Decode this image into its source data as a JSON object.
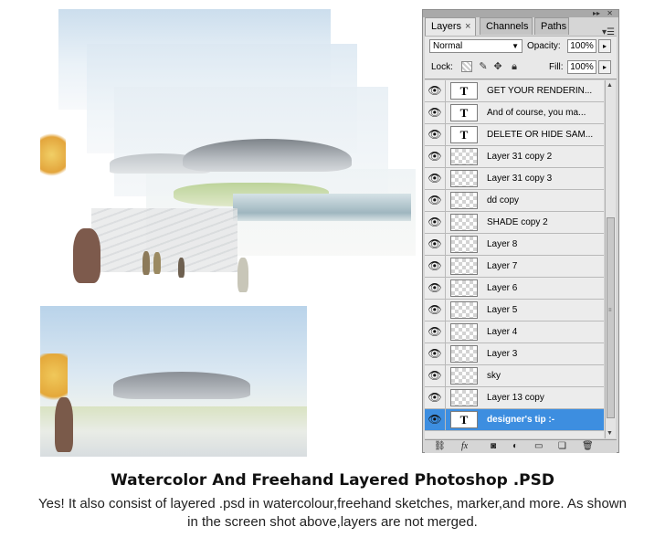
{
  "panel": {
    "tabs": [
      {
        "label": "Layers",
        "close": "×"
      },
      {
        "label": "Channels"
      },
      {
        "label": "Paths"
      }
    ],
    "blend_mode": "Normal",
    "opacity_label": "Opacity:",
    "opacity_value": "100%",
    "lock_label": "Lock:",
    "fill_label": "Fill:",
    "fill_value": "100%",
    "layers": [
      {
        "name": "GET YOUR RENDERIN...",
        "kind": "text",
        "thumb": "T"
      },
      {
        "name": "And of course, you ma...",
        "kind": "text",
        "thumb": "T"
      },
      {
        "name": "DELETE OR HIDE SAM...",
        "kind": "text",
        "thumb": "T"
      },
      {
        "name": "Layer 31 copy 2",
        "kind": "raster"
      },
      {
        "name": "Layer 31 copy 3",
        "kind": "raster"
      },
      {
        "name": "dd copy",
        "kind": "raster"
      },
      {
        "name": "SHADE copy 2",
        "kind": "raster"
      },
      {
        "name": "Layer 8",
        "kind": "raster"
      },
      {
        "name": "Layer 7",
        "kind": "raster"
      },
      {
        "name": "Layer 6",
        "kind": "raster"
      },
      {
        "name": "Layer 5",
        "kind": "raster"
      },
      {
        "name": "Layer 4",
        "kind": "raster"
      },
      {
        "name": "Layer 3",
        "kind": "raster"
      },
      {
        "name": "sky",
        "kind": "raster"
      },
      {
        "name": "Layer 13 copy",
        "kind": "raster"
      },
      {
        "name": "designer's tip :-",
        "kind": "text",
        "thumb": "T",
        "selected": true
      }
    ],
    "bottom_icons": [
      "link-icon",
      "fx-icon",
      "mask-icon",
      "adjustment-icon",
      "group-folder-icon",
      "new-layer-icon",
      "trash-icon"
    ],
    "bottom_fx": "fx",
    "selected_color": "#3d8ee0"
  },
  "caption": {
    "title": "Watercolor And Freehand Layered Photoshop .PSD",
    "body": "Yes! It also consist of layered .psd in watercolour,freehand sketches, marker,and more. As shown in the screen shot above,layers are not merged."
  }
}
